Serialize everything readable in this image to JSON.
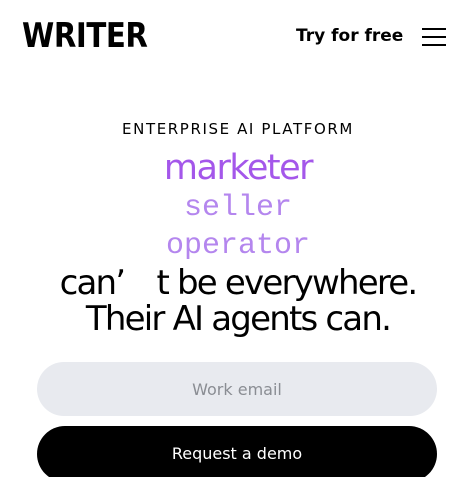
{
  "header": {
    "logo_text": "WRITER",
    "try_link": "Try for free",
    "menu_icon": "hamburger-menu-icon"
  },
  "hero": {
    "eyebrow": "ENTERPRISE AI PLATFORM",
    "roles": [
      "marketer",
      "seller",
      "operator"
    ],
    "headline_line1": "can’ t be everywhere.",
    "headline_line2": "Their AI agents can."
  },
  "form": {
    "email_placeholder": "Work email",
    "email_value": "",
    "submit_label": "Request a demo"
  },
  "colors": {
    "accent": "#a457ea",
    "accent_light": "#b486ee",
    "input_bg": "#e8eaef",
    "button_bg": "#000000"
  }
}
